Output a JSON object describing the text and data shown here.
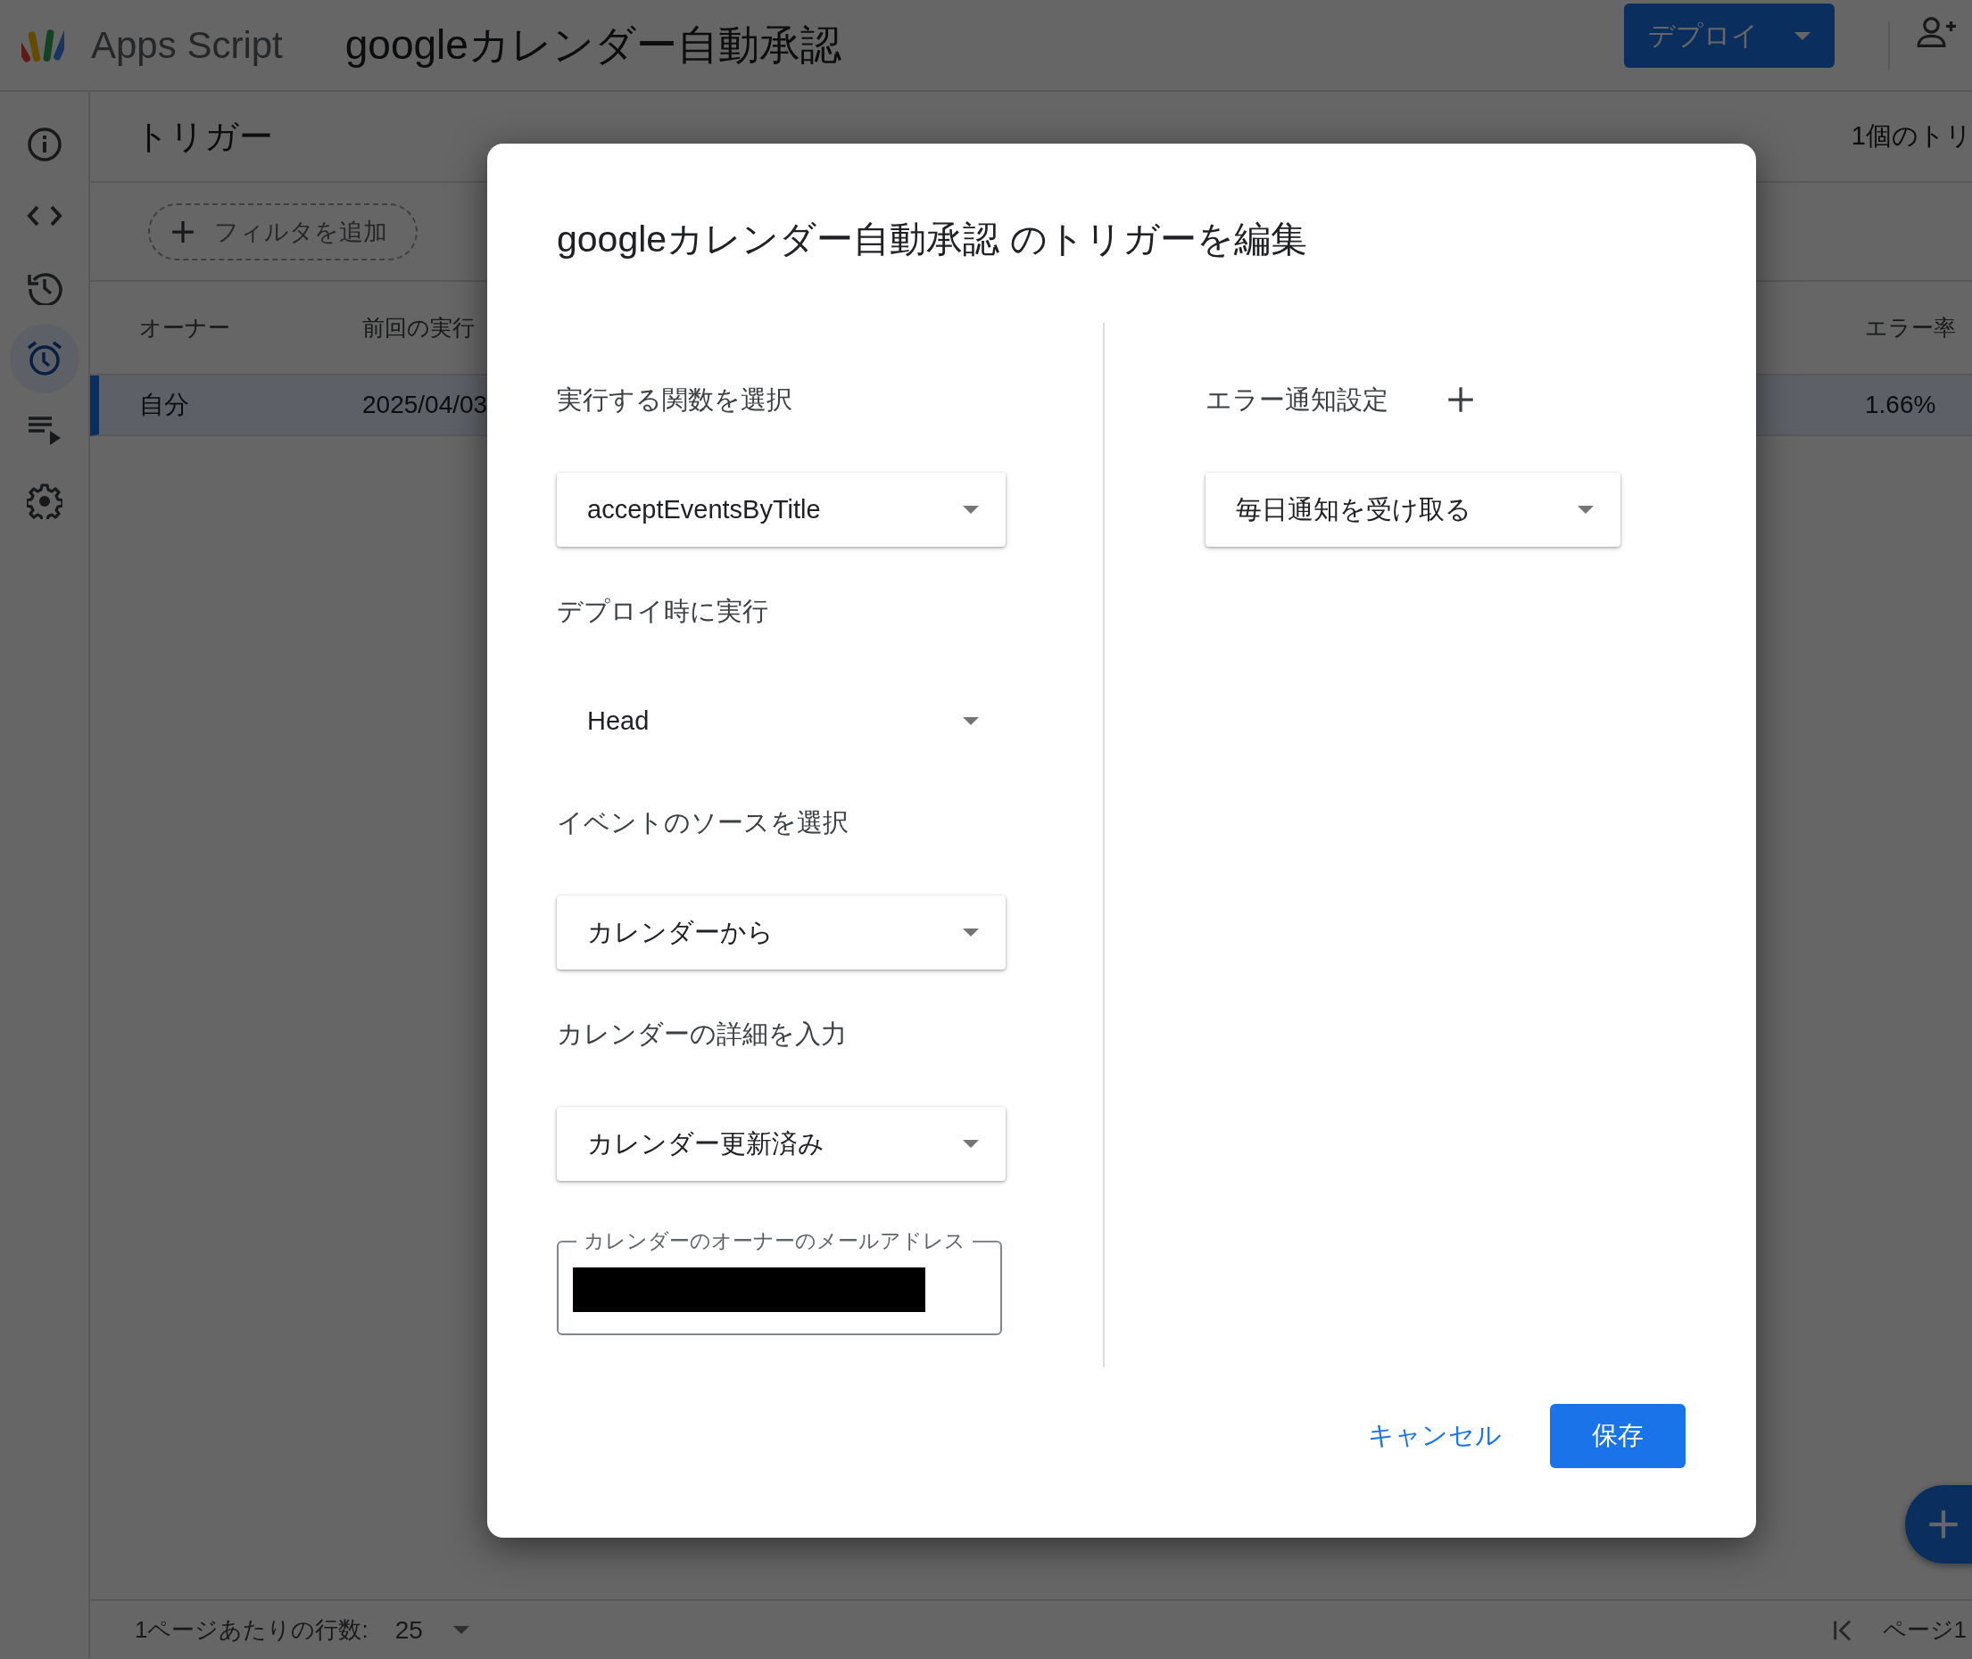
{
  "app": {
    "name": "Apps Script",
    "project_title": "googleカレンダー自動承認",
    "deploy_button": "デプロイ"
  },
  "sidebar": {
    "items": [
      {
        "kind": "info",
        "selected": false
      },
      {
        "kind": "code",
        "selected": false
      },
      {
        "kind": "history",
        "selected": false
      },
      {
        "kind": "alarm",
        "selected": true
      },
      {
        "kind": "executions",
        "selected": false
      },
      {
        "kind": "settings",
        "selected": false
      }
    ]
  },
  "page": {
    "title": "トリガー",
    "count": "1個のトリ",
    "filter_button": "フィルタを追加"
  },
  "table": {
    "columns": [
      "オーナー",
      "前回の実行",
      "エラー率"
    ],
    "rows": [
      {
        "cells": [
          "自分",
          "2025/04/03",
          "1.66%"
        ],
        "selected": true
      }
    ]
  },
  "footer": {
    "rows_per_page_label": "1ページあたりの行数:",
    "rows_per_page": "25",
    "page_label": "ページ1"
  },
  "dialog": {
    "title": "googleカレンダー自動承認 のトリガーを編集",
    "left_fields": [
      {
        "label": "実行する関数を選択",
        "value": "acceptEventsByTitle",
        "kind": "raised"
      },
      {
        "label": "デプロイ時に実行",
        "value": "Head",
        "kind": "flat"
      },
      {
        "label": "イベントのソースを選択",
        "value": "カレンダーから",
        "kind": "raised"
      },
      {
        "label": "カレンダーの詳細を入力",
        "value": "カレンダー更新済み",
        "kind": "raised"
      }
    ],
    "email_field": {
      "label": "カレンダーのオーナーのメールアドレス",
      "redacted": true
    },
    "notification": {
      "label": "エラー通知設定",
      "value": "毎日通知を受け取る"
    },
    "cancel_button": "キャンセル",
    "save_button": "保存"
  }
}
